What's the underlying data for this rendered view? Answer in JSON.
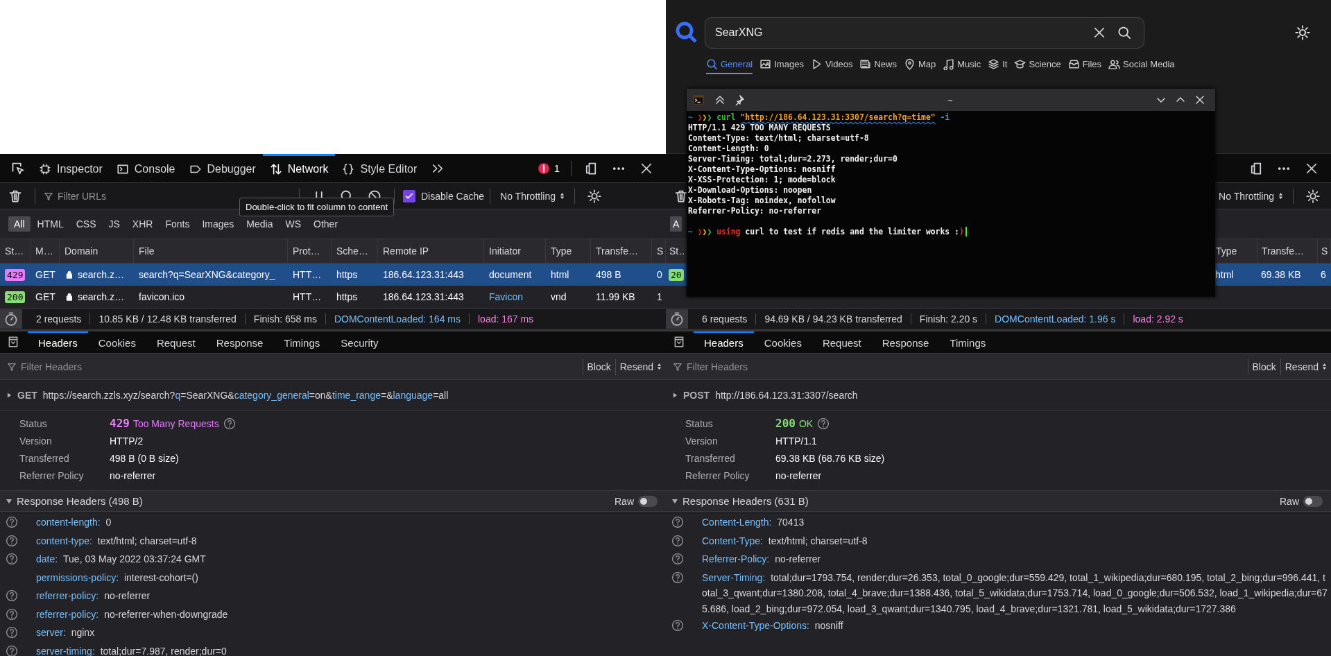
{
  "searxng": {
    "query": "SearXNG",
    "categories": [
      {
        "label": "General",
        "selected": true
      },
      {
        "label": "Images",
        "selected": false
      },
      {
        "label": "Videos",
        "selected": false
      },
      {
        "label": "News",
        "selected": false
      },
      {
        "label": "Map",
        "selected": false
      },
      {
        "label": "Music",
        "selected": false
      },
      {
        "label": "It",
        "selected": false
      },
      {
        "label": "Science",
        "selected": false
      },
      {
        "label": "Files",
        "selected": false
      },
      {
        "label": "Social Media",
        "selected": false
      }
    ]
  },
  "terminal": {
    "title": "~",
    "lines": [
      {
        "kind": "prompt",
        "segments": [
          {
            "text": "~ ",
            "color": "#3b82d6"
          },
          {
            "text": "❯",
            "color": "#e0332b"
          },
          {
            "text": "❯",
            "color": "#e8c22c"
          },
          {
            "text": "❯ ",
            "color": "#3fc43f"
          },
          {
            "text": "curl ",
            "color": "#3fc43f"
          },
          {
            "text": "\"http://186.64.123.31:3307/search?q=time\"",
            "color": "#f0a030",
            "underlined": true
          },
          {
            "text": " -i",
            "color": "#2aa8b8"
          }
        ]
      },
      {
        "kind": "output",
        "text": "HTTP/1.1 429 TOO MANY REQUESTS"
      },
      {
        "kind": "output",
        "text": "Content-Type: text/html; charset=utf-8"
      },
      {
        "kind": "output",
        "text": "Content-Length: 0"
      },
      {
        "kind": "output",
        "text": "Server-Timing: total;dur=2.273, render;dur=0"
      },
      {
        "kind": "output",
        "text": "X-Content-Type-Options: nosniff"
      },
      {
        "kind": "output",
        "text": "X-XSS-Protection: 1; mode=block"
      },
      {
        "kind": "output",
        "text": "X-Download-Options: noopen"
      },
      {
        "kind": "output",
        "text": "X-Robots-Tag: noindex, nofollow"
      },
      {
        "kind": "output",
        "text": "Referrer-Policy: no-referrer"
      },
      {
        "kind": "blank"
      },
      {
        "kind": "prompt",
        "cursor": true,
        "segments": [
          {
            "text": "~ ",
            "color": "#3b82d6"
          },
          {
            "text": "❯",
            "color": "#e0332b"
          },
          {
            "text": "❯",
            "color": "#e8c22c"
          },
          {
            "text": "❯ ",
            "color": "#3fc43f"
          },
          {
            "text": "using",
            "color": "#e0332b"
          },
          {
            "text": " curl to test if redis and the limiter works :",
            "color": "#f2f2f2"
          },
          {
            "text": ")",
            "color": "#e0332b"
          }
        ]
      }
    ]
  },
  "devtools_left": {
    "toolbox_tabs": [
      {
        "label": "Inspector",
        "selected": false
      },
      {
        "label": "Console",
        "selected": false
      },
      {
        "label": "Debugger",
        "selected": false
      },
      {
        "label": "Network",
        "selected": true
      },
      {
        "label": "Style Editor",
        "selected": false
      }
    ],
    "error_count": "1",
    "filter_placeholder": "Filter URLs",
    "disable_cache": {
      "label": "Disable Cache",
      "checked": true
    },
    "throttling": "No Throttling",
    "tooltip": "Double-click to fit column to content",
    "type_filters": [
      {
        "label": "All",
        "selected": true
      },
      {
        "label": "HTML",
        "selected": false
      },
      {
        "label": "CSS",
        "selected": false
      },
      {
        "label": "JS",
        "selected": false
      },
      {
        "label": "XHR",
        "selected": false
      },
      {
        "label": "Fonts",
        "selected": false
      },
      {
        "label": "Images",
        "selected": false
      },
      {
        "label": "Media",
        "selected": false
      },
      {
        "label": "WS",
        "selected": false
      },
      {
        "label": "Other",
        "selected": false
      }
    ],
    "columns": [
      "St…",
      "M…",
      "Domain",
      "File",
      "Prot…",
      "Sche…",
      "Remote IP",
      "Initiator",
      "Type",
      "Transfe…",
      "S"
    ],
    "rows": [
      {
        "selected": true,
        "status": {
          "code": "429",
          "kind": "error"
        },
        "method": "GET",
        "secure": true,
        "domain": "search.z…",
        "file": "search?q=SearXNG&category_",
        "protocol": "HTT…",
        "scheme": "https",
        "remote_ip": "186.64.123.31:443",
        "initiator": {
          "text": "document",
          "link": false
        },
        "type": "html",
        "transferred": "498 B",
        "size": "0"
      },
      {
        "selected": false,
        "status": {
          "code": "200",
          "kind": "success"
        },
        "method": "GET",
        "secure": true,
        "domain": "search.z…",
        "file": "favicon.ico",
        "protocol": "HTT…",
        "scheme": "https",
        "remote_ip": "186.64.123.31:443",
        "initiator": {
          "text": "Favicon",
          "link": true
        },
        "type": "vnd",
        "transferred": "11.99 KB",
        "size": "1"
      }
    ],
    "status_bar": {
      "requests": "2 requests",
      "transferred": "10.85 KB / 12.48 KB transferred",
      "finish": "Finish: 658 ms",
      "dom": "DOMContentLoaded: 164 ms",
      "load": "load: 167 ms"
    },
    "detail_tabs": [
      {
        "label": "Headers",
        "selected": true
      },
      {
        "label": "Cookies",
        "selected": false
      },
      {
        "label": "Request",
        "selected": false
      },
      {
        "label": "Response",
        "selected": false
      },
      {
        "label": "Timings",
        "selected": false
      },
      {
        "label": "Security",
        "selected": false
      }
    ],
    "filter_headers_placeholder": "Filter Headers",
    "block": "Block",
    "resend": "Resend",
    "request": {
      "method": "GET",
      "url": [
        {
          "text": "https://search.zzls.xyz/search?",
          "kind": "plain"
        },
        {
          "text": "q",
          "kind": "param"
        },
        {
          "text": "=SearXNG&",
          "kind": "plain"
        },
        {
          "text": "category_general",
          "kind": "param"
        },
        {
          "text": "=on&",
          "kind": "plain"
        },
        {
          "text": "time_range",
          "kind": "param"
        },
        {
          "text": "=&",
          "kind": "plain"
        },
        {
          "text": "language",
          "kind": "param"
        },
        {
          "text": "=all",
          "kind": "plain"
        }
      ]
    },
    "summary": [
      {
        "label": "Status",
        "code": "429",
        "kind": "error",
        "value": "Too Many Requests"
      },
      {
        "label": "Version",
        "value": "HTTP/2"
      },
      {
        "label": "Transferred",
        "value": "498 B (0 B size)"
      },
      {
        "label": "Referrer Policy",
        "value": "no-referrer"
      }
    ],
    "response_headers": {
      "title": "Response Headers (498 B)",
      "raw": {
        "label": "Raw",
        "on": false
      },
      "rows": [
        {
          "name": "content-length:",
          "value": "0",
          "help": true
        },
        {
          "name": "content-type:",
          "value": "text/html; charset=utf-8",
          "help": true
        },
        {
          "name": "date:",
          "value": "Tue, 03 May 2022 03:37:24 GMT",
          "help": true
        },
        {
          "name": "permissions-policy:",
          "value": "interest-cohort=()",
          "help": false
        },
        {
          "name": "referrer-policy:",
          "value": "no-referrer",
          "help": true
        },
        {
          "name": "referrer-policy:",
          "value": "no-referrer-when-downgrade",
          "help": true
        },
        {
          "name": "server:",
          "value": "nginx",
          "help": true
        },
        {
          "name": "server-timing:",
          "value": "total;dur=7.987, render;dur=0",
          "help": true
        }
      ]
    }
  },
  "devtools_right": {
    "throttling": "No Throttling",
    "type_filter": {
      "label": "A",
      "selected": true
    },
    "columns_left": [
      "St…"
    ],
    "columns_right": [
      "Type",
      "Transfe…",
      "S"
    ],
    "row": {
      "selected": true,
      "status": {
        "code": "20",
        "kind": "success"
      },
      "type": "html",
      "transferred": "69.38 KB",
      "size": "6"
    },
    "status_bar": {
      "requests": "6 requests",
      "transferred": "94.69 KB / 94.23 KB transferred",
      "finish": "Finish: 2.20 s",
      "dom": "DOMContentLoaded: 1.96 s",
      "load": "load: 2.92 s"
    },
    "detail_tabs": [
      {
        "label": "Headers",
        "selected": true
      },
      {
        "label": "Cookies",
        "selected": false
      },
      {
        "label": "Request",
        "selected": false
      },
      {
        "label": "Response",
        "selected": false
      },
      {
        "label": "Timings",
        "selected": false
      }
    ],
    "filter_headers_placeholder": "Filter Headers",
    "block": "Block",
    "resend": "Resend",
    "request": {
      "method": "POST",
      "url": [
        {
          "text": "http://186.64.123.31:3307/search",
          "kind": "plain"
        }
      ]
    },
    "summary": [
      {
        "label": "Status",
        "code": "200",
        "kind": "success",
        "value": "OK"
      },
      {
        "label": "Version",
        "value": "HTTP/1.1"
      },
      {
        "label": "Transferred",
        "value": "69.38 KB (68.76 KB size)"
      },
      {
        "label": "Referrer Policy",
        "value": "no-referrer"
      }
    ],
    "response_headers": {
      "title": "Response Headers (631 B)",
      "raw": {
        "label": "Raw",
        "on": false
      },
      "rows": [
        {
          "name": "Content-Length:",
          "value": "70413",
          "help": true
        },
        {
          "name": "Content-Type:",
          "value": "text/html; charset=utf-8",
          "help": true
        },
        {
          "name": "Referrer-Policy:",
          "value": "no-referrer",
          "help": true
        },
        {
          "name": "Server-Timing:",
          "value": "total;dur=1793.754, render;dur=26.353, total_0_google;dur=559.429, total_1_wikipedia;dur=680.195, total_2_bing;dur=996.441, total_3_qwant;dur=1380.208, total_4_brave;dur=1388.436, total_5_wikidata;dur=1753.714, load_0_google;dur=506.532, load_1_wikipedia;dur=675.686, load_2_bing;dur=972.054, load_3_qwant;dur=1340.795, load_4_brave;dur=1321.781, load_5_wikidata;dur=1727.386",
          "help": true
        },
        {
          "name": "X-Content-Type-Options:",
          "value": "nosniff",
          "help": true
        }
      ]
    }
  }
}
